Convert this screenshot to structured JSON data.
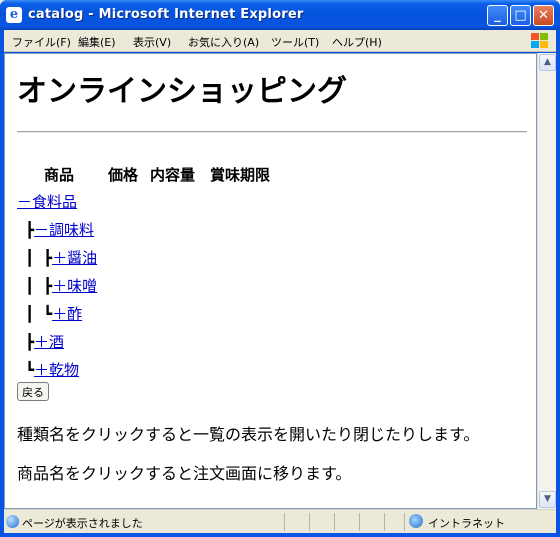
{
  "window": {
    "title": "catalog - Microsoft Internet Explorer",
    "minimize": "_",
    "maximize": "□",
    "close": "✕"
  },
  "menu": [
    "ファイル(F)",
    "編集(E)",
    "表示(V)",
    "お気に入り(A)",
    "ツール(T)",
    "ヘルプ(H)"
  ],
  "page": {
    "title": "オンラインショッピング",
    "columns": [
      "商品",
      "価格",
      "内容量",
      "賞味期限"
    ],
    "tree": [
      {
        "prefix": "",
        "label": "－食料品"
      },
      {
        "prefix": "┣",
        "label": "－調味料"
      },
      {
        "prefix": "┃ ┣",
        "label": "＋醤油"
      },
      {
        "prefix": "┃ ┣",
        "label": "＋味噌"
      },
      {
        "prefix": "┃ ┗",
        "label": "＋酢"
      },
      {
        "prefix": "┣",
        "label": "＋酒"
      },
      {
        "prefix": "┗",
        "label": "＋乾物"
      }
    ],
    "back_button": "戻る",
    "notes": [
      "種類名をクリックすると一覧の表示を開いたり閉じたりします。",
      "商品名をクリックすると注文画面に移ります。"
    ]
  },
  "status": {
    "text": "ページが表示されました",
    "zone": "イントラネット"
  },
  "colors": {
    "titlebar": "#0553dd",
    "link": "#0000cc",
    "chrome": "#ece9d8"
  }
}
